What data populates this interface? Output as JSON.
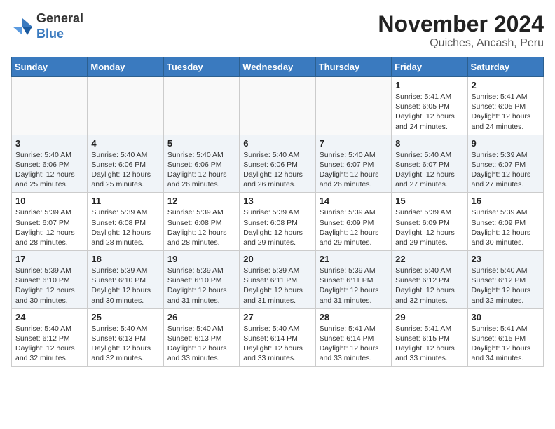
{
  "header": {
    "logo_general": "General",
    "logo_blue": "Blue",
    "title": "November 2024",
    "subtitle": "Quiches, Ancash, Peru"
  },
  "weekdays": [
    "Sunday",
    "Monday",
    "Tuesday",
    "Wednesday",
    "Thursday",
    "Friday",
    "Saturday"
  ],
  "weeks": [
    [
      {
        "day": "",
        "info": ""
      },
      {
        "day": "",
        "info": ""
      },
      {
        "day": "",
        "info": ""
      },
      {
        "day": "",
        "info": ""
      },
      {
        "day": "",
        "info": ""
      },
      {
        "day": "1",
        "info": "Sunrise: 5:41 AM\nSunset: 6:05 PM\nDaylight: 12 hours and 24 minutes."
      },
      {
        "day": "2",
        "info": "Sunrise: 5:41 AM\nSunset: 6:05 PM\nDaylight: 12 hours and 24 minutes."
      }
    ],
    [
      {
        "day": "3",
        "info": "Sunrise: 5:40 AM\nSunset: 6:06 PM\nDaylight: 12 hours and 25 minutes."
      },
      {
        "day": "4",
        "info": "Sunrise: 5:40 AM\nSunset: 6:06 PM\nDaylight: 12 hours and 25 minutes."
      },
      {
        "day": "5",
        "info": "Sunrise: 5:40 AM\nSunset: 6:06 PM\nDaylight: 12 hours and 26 minutes."
      },
      {
        "day": "6",
        "info": "Sunrise: 5:40 AM\nSunset: 6:06 PM\nDaylight: 12 hours and 26 minutes."
      },
      {
        "day": "7",
        "info": "Sunrise: 5:40 AM\nSunset: 6:07 PM\nDaylight: 12 hours and 26 minutes."
      },
      {
        "day": "8",
        "info": "Sunrise: 5:40 AM\nSunset: 6:07 PM\nDaylight: 12 hours and 27 minutes."
      },
      {
        "day": "9",
        "info": "Sunrise: 5:39 AM\nSunset: 6:07 PM\nDaylight: 12 hours and 27 minutes."
      }
    ],
    [
      {
        "day": "10",
        "info": "Sunrise: 5:39 AM\nSunset: 6:07 PM\nDaylight: 12 hours and 28 minutes."
      },
      {
        "day": "11",
        "info": "Sunrise: 5:39 AM\nSunset: 6:08 PM\nDaylight: 12 hours and 28 minutes."
      },
      {
        "day": "12",
        "info": "Sunrise: 5:39 AM\nSunset: 6:08 PM\nDaylight: 12 hours and 28 minutes."
      },
      {
        "day": "13",
        "info": "Sunrise: 5:39 AM\nSunset: 6:08 PM\nDaylight: 12 hours and 29 minutes."
      },
      {
        "day": "14",
        "info": "Sunrise: 5:39 AM\nSunset: 6:09 PM\nDaylight: 12 hours and 29 minutes."
      },
      {
        "day": "15",
        "info": "Sunrise: 5:39 AM\nSunset: 6:09 PM\nDaylight: 12 hours and 29 minutes."
      },
      {
        "day": "16",
        "info": "Sunrise: 5:39 AM\nSunset: 6:09 PM\nDaylight: 12 hours and 30 minutes."
      }
    ],
    [
      {
        "day": "17",
        "info": "Sunrise: 5:39 AM\nSunset: 6:10 PM\nDaylight: 12 hours and 30 minutes."
      },
      {
        "day": "18",
        "info": "Sunrise: 5:39 AM\nSunset: 6:10 PM\nDaylight: 12 hours and 30 minutes."
      },
      {
        "day": "19",
        "info": "Sunrise: 5:39 AM\nSunset: 6:10 PM\nDaylight: 12 hours and 31 minutes."
      },
      {
        "day": "20",
        "info": "Sunrise: 5:39 AM\nSunset: 6:11 PM\nDaylight: 12 hours and 31 minutes."
      },
      {
        "day": "21",
        "info": "Sunrise: 5:39 AM\nSunset: 6:11 PM\nDaylight: 12 hours and 31 minutes."
      },
      {
        "day": "22",
        "info": "Sunrise: 5:40 AM\nSunset: 6:12 PM\nDaylight: 12 hours and 32 minutes."
      },
      {
        "day": "23",
        "info": "Sunrise: 5:40 AM\nSunset: 6:12 PM\nDaylight: 12 hours and 32 minutes."
      }
    ],
    [
      {
        "day": "24",
        "info": "Sunrise: 5:40 AM\nSunset: 6:12 PM\nDaylight: 12 hours and 32 minutes."
      },
      {
        "day": "25",
        "info": "Sunrise: 5:40 AM\nSunset: 6:13 PM\nDaylight: 12 hours and 32 minutes."
      },
      {
        "day": "26",
        "info": "Sunrise: 5:40 AM\nSunset: 6:13 PM\nDaylight: 12 hours and 33 minutes."
      },
      {
        "day": "27",
        "info": "Sunrise: 5:40 AM\nSunset: 6:14 PM\nDaylight: 12 hours and 33 minutes."
      },
      {
        "day": "28",
        "info": "Sunrise: 5:41 AM\nSunset: 6:14 PM\nDaylight: 12 hours and 33 minutes."
      },
      {
        "day": "29",
        "info": "Sunrise: 5:41 AM\nSunset: 6:15 PM\nDaylight: 12 hours and 33 minutes."
      },
      {
        "day": "30",
        "info": "Sunrise: 5:41 AM\nSunset: 6:15 PM\nDaylight: 12 hours and 34 minutes."
      }
    ]
  ]
}
